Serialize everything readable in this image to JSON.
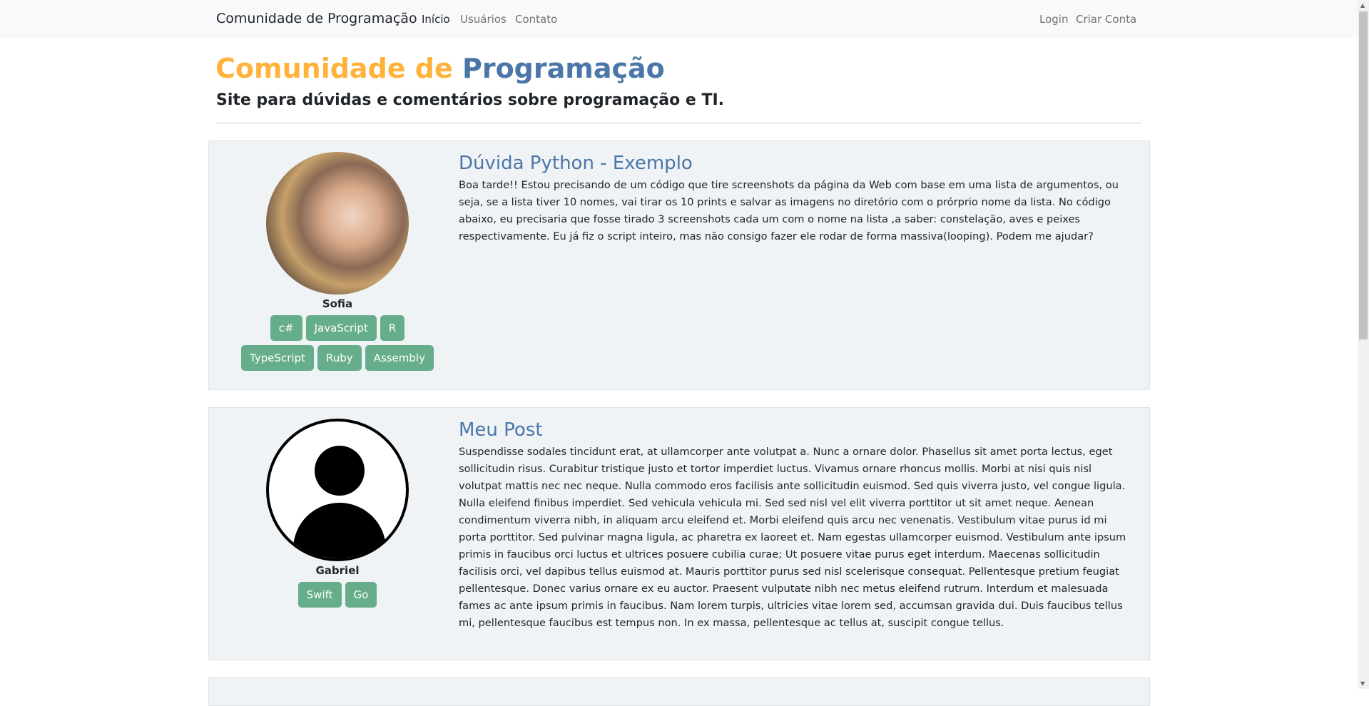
{
  "navbar": {
    "brand": "Comunidade de Programação",
    "links": [
      "Início",
      "Usuários",
      "Contato"
    ],
    "right_links": [
      "Login",
      "Criar Conta"
    ]
  },
  "header": {
    "title_part1": "Comunidade de",
    "title_part2": "Programação",
    "subtitle": "Site para dúvidas e comentários sobre programação e TI."
  },
  "colors": {
    "accent_orange": "#ffb33b",
    "accent_blue": "#4a76a8",
    "tag": "#66ad8b"
  },
  "posts": [
    {
      "author": "Sofia",
      "tags": [
        "c#",
        "JavaScript",
        "R",
        "TypeScript",
        "Ruby",
        "Assembly"
      ],
      "title": "Dúvida Python - Exemplo",
      "body": "Boa tarde!! Estou precisando de um código que tire screenshots da página da Web com base em uma lista de argumentos, ou seja, se a lista tiver 10 nomes, vai tirar os 10 prints e salvar as imagens no diretório com o prórprio nome da lista. No código abaixo, eu precisaria que fosse tirado 3 screenshots cada um com o nome na lista ,a saber: constelação, aves e peixes respectivamente. Eu já fiz o script inteiro, mas não consigo fazer ele rodar de forma massiva(looping). Podem me ajudar?"
    },
    {
      "author": "Gabriel",
      "tags": [
        "Swift",
        "Go"
      ],
      "title": "Meu Post",
      "body": "Suspendisse sodales tincidunt erat, at ullamcorper ante volutpat a. Nunc a ornare dolor. Phasellus sit amet porta lectus, eget sollicitudin risus. Curabitur tristique justo et tortor imperdiet luctus. Vivamus ornare rhoncus mollis. Morbi at nisi quis nisl volutpat mattis nec nec neque. Nulla commodo eros facilisis ante sollicitudin euismod. Sed quis viverra justo, vel congue ligula. Nulla eleifend finibus imperdiet. Sed vehicula vehicula mi. Sed sed nisl vel elit viverra porttitor ut sit amet neque. Aenean condimentum viverra nibh, in aliquam arcu eleifend et. Morbi eleifend quis arcu nec venenatis. Vestibulum vitae purus id mi porta porttitor. Sed pulvinar magna ligula, ac pharetra ex laoreet et. Nam egestas ullamcorper euismod. Vestibulum ante ipsum primis in faucibus orci luctus et ultrices posuere cubilia curae; Ut posuere vitae purus eget interdum. Maecenas sollicitudin facilisis orci, vel dapibus tellus euismod at. Mauris porttitor purus sed nisl scelerisque consequat. Pellentesque pretium feugiat pellentesque. Donec varius ornare ex eu auctor. Praesent vulputate nibh nec metus eleifend rutrum. Interdum et malesuada fames ac ante ipsum primis in faucibus. Nam lorem turpis, ultricies vitae lorem sed, accumsan gravida dui. Duis faucibus tellus mi, pellentesque faucibus est tempus non. In ex massa, pellentesque ac tellus at, suscipit congue tellus."
    }
  ]
}
